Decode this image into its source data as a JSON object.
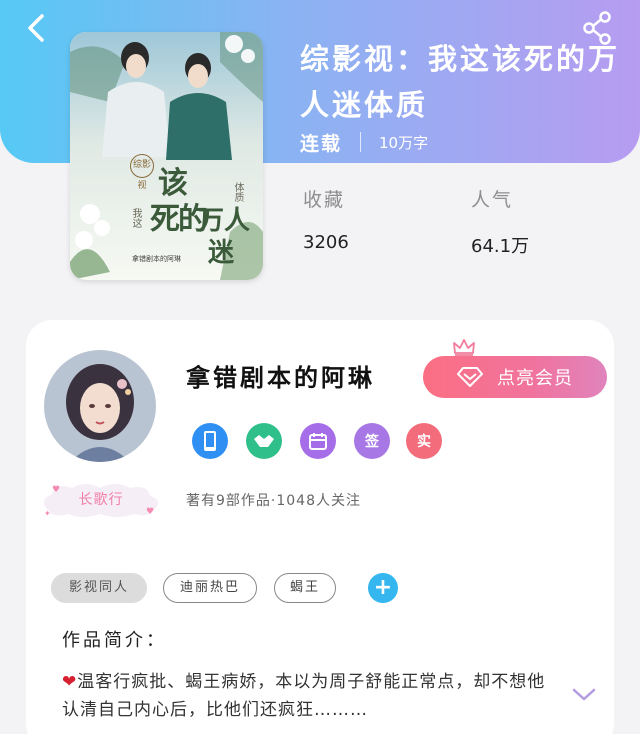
{
  "header": {
    "title": "综影视：我这该死的万人迷体质",
    "status": "连载",
    "word_count": "10万字"
  },
  "stats": {
    "favorites": {
      "label": "收藏",
      "value": "3206"
    },
    "popularity": {
      "label": "人气",
      "value": "64.1万"
    }
  },
  "cover": {
    "series_text": "综影视",
    "line1": "该",
    "line2": "死的",
    "line3": "万人",
    "line4": "迷",
    "subtitle": "我这",
    "side_text": "体质",
    "author_text": "拿错剧本的阿琳"
  },
  "author": {
    "name": "拿错剧本的阿琳",
    "rank": "长歌行",
    "works_info": "著有9部作品·1048人关注",
    "member_button": "点亮会员",
    "badges": [
      {
        "name": "phone-badge",
        "color": "#2f8ff3"
      },
      {
        "name": "handshake-badge",
        "color": "#2fbf8a"
      },
      {
        "name": "calendar-badge",
        "color": "#a66de8"
      },
      {
        "name": "sign-badge",
        "label": "签",
        "color": "#a777e6"
      },
      {
        "name": "real-badge",
        "label": "实",
        "color": "#f26c7c"
      }
    ]
  },
  "tags": [
    "影视同人",
    "迪丽热巴",
    "蝎王"
  ],
  "intro": {
    "title": "作品简介：",
    "text": "温客行疯批、蝎王病娇，本以为周子舒能正常点，却不想他认清自己内心后，比他们还疯狂………"
  },
  "colors": {
    "header_start": "#56c9f4",
    "header_end": "#b79cf1",
    "member_button": "#f7708f",
    "add_tag": "#35b6ee"
  }
}
